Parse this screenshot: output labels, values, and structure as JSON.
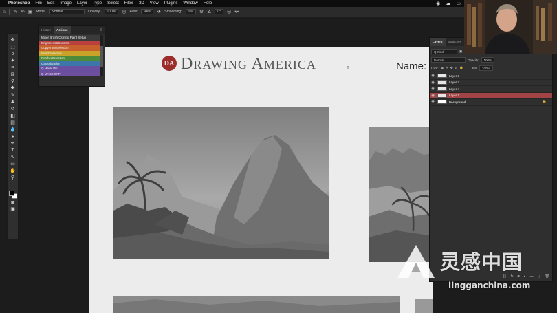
{
  "menubar": {
    "app": "Photoshop",
    "items": [
      "File",
      "Edit",
      "Image",
      "Layer",
      "Type",
      "Select",
      "Filter",
      "3D",
      "View",
      "Plugins",
      "Window",
      "Help"
    ]
  },
  "options": {
    "brush_size": "45",
    "mode_label": "Mode:",
    "mode_value": "Normal",
    "opacity_label": "Opacity:",
    "opacity_value": "100%",
    "flow_label": "Flow:",
    "flow_value": "94%",
    "smoothing_label": "Smoothing:",
    "smoothing_value": "0%",
    "angle_value": "0°"
  },
  "actions_panel": {
    "tabs": [
      "History",
      "Actions"
    ],
    "active_tab": "Actions",
    "items": [
      {
        "label": "Mixer Brush Cloning Paint Setup",
        "color": "#3a3a3a"
      },
      {
        "label": "Brightness&Contrast",
        "color": "#b9403c"
      },
      {
        "label": "CopyFromSelection",
        "color": "#c7602d"
      },
      {
        "label": "InvertSelection",
        "color": "#c9a228"
      },
      {
        "label": "FeatherSelection",
        "color": "#4d8a3a"
      },
      {
        "label": "GaussianBlur",
        "color": "#3d76a8"
      },
      {
        "label": "Q Mask ON",
        "color": "#6a4fa0"
      },
      {
        "label": "Q MASK OFF",
        "color": "#6d4f9e"
      }
    ]
  },
  "document": {
    "brand_monogram": "DA",
    "brand_name_1": "D",
    "brand_name_2": "RAWING",
    "brand_name_3": " A",
    "brand_name_4": "MERICA",
    "brand_reg": "®",
    "name_label": "Name:"
  },
  "layers_panel": {
    "tabs": [
      "Layers",
      "Swatches"
    ],
    "active_tab": "Layers",
    "filter": "Q Kind",
    "blend_mode": "Normal",
    "opacity_label": "Opacity:",
    "opacity_value": "100%",
    "lock_label": "Lock:",
    "fill_label": "Fill:",
    "fill_value": "100%",
    "layers": [
      {
        "name": "Layer 3",
        "selected": false
      },
      {
        "name": "Layer 2",
        "selected": false
      },
      {
        "name": "Layer 4",
        "selected": false
      },
      {
        "name": "Layer 1",
        "selected": true
      },
      {
        "name": "Background",
        "selected": false
      }
    ]
  },
  "watermark": {
    "chinese": "灵感中国",
    "url": "lingganchina.com"
  }
}
